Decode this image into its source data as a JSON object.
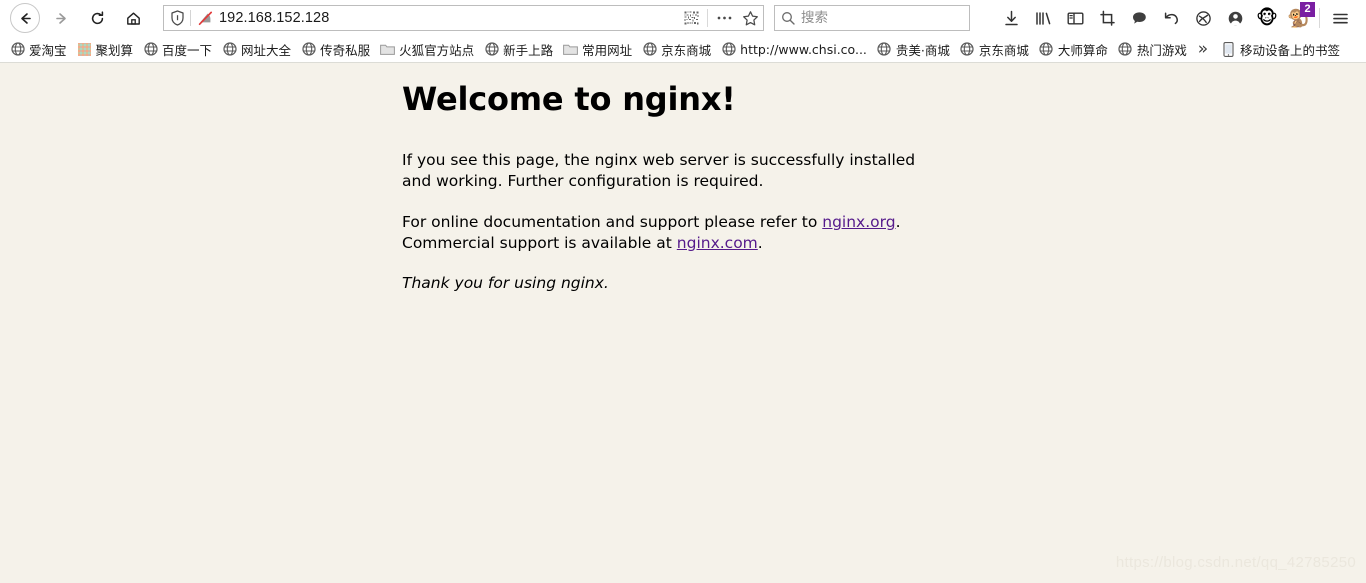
{
  "browser": {
    "nav": {
      "back_icon": "arrow-left-icon",
      "forward_icon": "arrow-right-icon",
      "reload_icon": "reload-icon",
      "home_icon": "home-icon"
    },
    "url_bar": {
      "value": "192.168.152.128",
      "shield_icon": "shield-icon",
      "tracking_blocked_icon": "tracking-protection-blocked-icon",
      "qr_icon": "qr-code-icon",
      "more_icon": "page-actions-ellipsis-icon",
      "bookmark_icon": "star-icon"
    },
    "search": {
      "placeholder": "搜索",
      "value": "",
      "icon": "search-icon"
    },
    "toolbar_icons": [
      {
        "name": "downloads-icon",
        "label": "下载"
      },
      {
        "name": "library-icon",
        "label": "库"
      },
      {
        "name": "sidebar-icon",
        "label": "侧边栏"
      },
      {
        "name": "screenshot-icon",
        "label": "截图"
      },
      {
        "name": "pocket-icon",
        "label": "稍后阅读"
      },
      {
        "name": "undo-icon",
        "label": "撤销"
      },
      {
        "name": "sync-icon",
        "label": "同步"
      },
      {
        "name": "account-icon",
        "label": "账户"
      }
    ],
    "extensions": [
      {
        "name": "monkey-extension-icon",
        "glyph": "🐵",
        "badge": ""
      },
      {
        "name": "monkey-extension-icon-2",
        "glyph": "🐒",
        "badge": "2"
      }
    ],
    "menu_icon": "hamburger-menu-icon",
    "bookmarks": [
      {
        "label": "爱淘宝",
        "icon": "globe-icon"
      },
      {
        "label": "聚划算",
        "icon": "colorful-favicon"
      },
      {
        "label": "百度一下",
        "icon": "globe-icon"
      },
      {
        "label": "网址大全",
        "icon": "globe-icon"
      },
      {
        "label": "传奇私服",
        "icon": "globe-icon"
      },
      {
        "label": "火狐官方站点",
        "icon": "folder-icon"
      },
      {
        "label": "新手上路",
        "icon": "globe-icon"
      },
      {
        "label": "常用网址",
        "icon": "folder-icon"
      },
      {
        "label": "京东商城",
        "icon": "globe-icon"
      },
      {
        "label": "http://www.chsi.co...",
        "icon": "globe-icon"
      },
      {
        "label": "贵美·商城",
        "icon": "globe-icon"
      },
      {
        "label": "京东商城",
        "icon": "globe-icon"
      },
      {
        "label": "大师算命",
        "icon": "globe-icon"
      },
      {
        "label": "热门游戏",
        "icon": "globe-icon"
      }
    ],
    "bookmarks_overflow_icon": "chevron-double-right-icon",
    "mobile_bookmarks": {
      "label": "移动设备上的书签",
      "icon": "mobile-device-icon"
    }
  },
  "page": {
    "title": "Welcome to nginx!",
    "paragraph1_a": "If you see this page, the nginx web server is successfully installed and",
    "paragraph1_b": "working. Further configuration is required.",
    "paragraph2_a": "For online documentation and support please refer to ",
    "paragraph2_link1": "nginx.org",
    "paragraph2_b": ".",
    "paragraph2_c": "Commercial support is available at ",
    "paragraph2_link2": "nginx.com",
    "paragraph2_d": ".",
    "paragraph3": "Thank you for using nginx.",
    "watermark": "https://blog.csdn.net/qq_42785250",
    "background_color": "#f5f2ea",
    "link_color": "#551a8b"
  }
}
